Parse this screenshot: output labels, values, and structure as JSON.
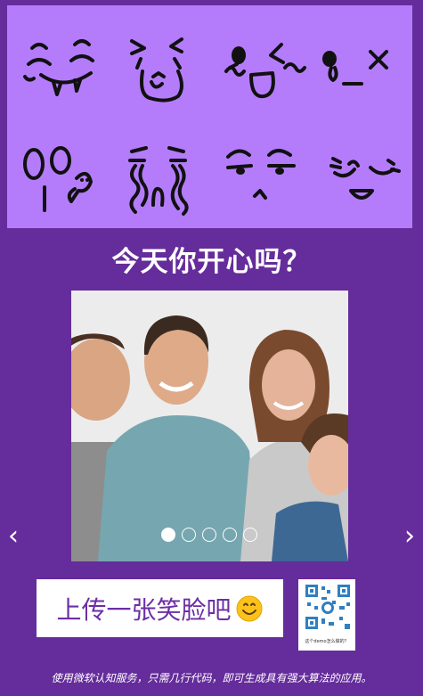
{
  "banner": {
    "faces": [
      "fangs-face-icon",
      "squint-face-icon",
      "wink-face-icon",
      "tongue-face-icon",
      "shocked-face-icon",
      "crying-face-icon",
      "suspicious-face-icon",
      "sleepy-face-icon"
    ]
  },
  "headline": "今天你开心吗？",
  "carousel": {
    "slide_count": 5,
    "active_index": 0,
    "prev_label": "‹",
    "next_label": "›"
  },
  "upload": {
    "label": "上传一张笑脸吧",
    "emoji_icon": "smiley-emoji-icon"
  },
  "qr": {
    "caption": "这个demo怎么做的？"
  },
  "footer": "使用微软认知服务，只需几行代码，即可生成具有强大算法的应用。",
  "colors": {
    "background": "#652c9b",
    "banner": "#b47cfb",
    "button_text": "#6b2ea6"
  }
}
